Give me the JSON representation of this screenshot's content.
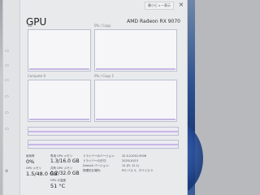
{
  "header": {
    "pin_label": "最小ビュー表示",
    "close_icon": "close-icon",
    "title": "GPU",
    "gpu_model": "AMD Radeon RX 9070"
  },
  "graphs": [
    {
      "left_label": "3D",
      "right_label": "0% / Copy"
    },
    {
      "left_label": "Compute 0",
      "right_label": "0% / Copy 1"
    }
  ],
  "strips": [
    {
      "left_label": "",
      "right_label": ""
    },
    {
      "left_label": "",
      "right_label": ""
    }
  ],
  "stats": {
    "util_label": "使用率",
    "util_value": "0%",
    "dedicated_label": "専用 GPU メモリ",
    "dedicated_value": "1.3/16.0 GB",
    "shared_label": "共有 GPU メモリ",
    "shared_value": "0.2/32.0 GB",
    "gpu_mem_label": "GPU メモリ",
    "gpu_mem_value": "1.5/48.0 GB",
    "temp_label": "GPU の温度",
    "temp_value": "51 °C",
    "driver_version_label": "ドライバーのバージョン:",
    "driver_version_value": "32.0.21001.9006",
    "driver_date_label": "ドライバーの日付:",
    "driver_date_value": "2025/10/13",
    "directx_label": "DirectX バージョン:",
    "directx_value": "12 (FL 12.1)",
    "location_label": "物理的な場所:",
    "location_value": "PCI バス 3、デバイス 0"
  },
  "colors": {
    "graph_border": "#b9c0cf",
    "graph_fill": "#c5b7e2",
    "background": "#e9eaec"
  }
}
